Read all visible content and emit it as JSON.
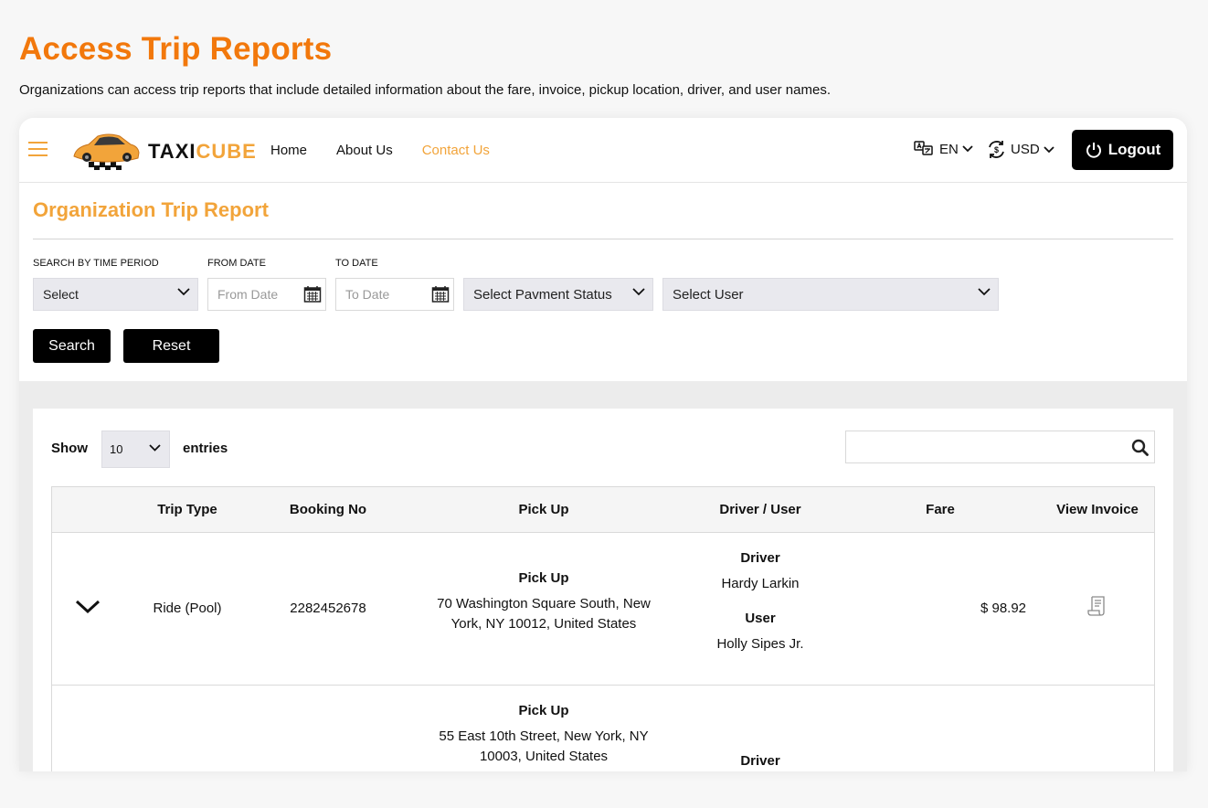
{
  "page": {
    "title": "Access Trip Reports",
    "description": "Organizations can access trip reports that include detailed information about the fare, invoice, pickup location, driver, and user names."
  },
  "header": {
    "brand_a": "TAXI",
    "brand_b": "CUBE",
    "nav": [
      "Home",
      "About Us",
      "Contact Us"
    ],
    "active_nav": "Contact Us",
    "language": "EN",
    "currency": "USD",
    "logout_label": "Logout"
  },
  "report": {
    "title": "Organization Trip Report",
    "filters": {
      "time_period_label": "SEARCH BY TIME PERIOD",
      "time_period_value": "Select",
      "from_label": "FROM DATE",
      "from_placeholder": "From Date",
      "to_label": "TO DATE",
      "to_placeholder": "To Date",
      "payment_status": "Select Pavment Status",
      "user": "Select User"
    },
    "search_label": "Search",
    "reset_label": "Reset"
  },
  "table": {
    "show_label": "Show",
    "entries_value": "10",
    "entries_label": "entries",
    "columns": [
      "Trip Type",
      "Booking No",
      "Pick Up",
      "Driver / User",
      "Fare",
      "View Invoice"
    ],
    "rows": [
      {
        "trip_type": "Ride (Pool)",
        "booking_no": "2282452678",
        "pickup_heading": "Pick Up",
        "pickup_line1": "70 Washington Square South, New",
        "pickup_line2": "York, NY 10012, United States",
        "driver_heading": "Driver",
        "driver": "Hardy Larkin",
        "user_heading": "User",
        "user": "Holly Sipes Jr.",
        "fare": "$ 98.92"
      },
      {
        "pickup_heading": "Pick Up",
        "pickup_line1": "55 East 10th Street, New York, NY",
        "pickup_line2": "10003, United States",
        "driver_heading": "Driver"
      }
    ]
  },
  "colors": {
    "accent_orange": "#f2780c",
    "brand_amber": "#f2a43a",
    "button_black": "#000000"
  }
}
